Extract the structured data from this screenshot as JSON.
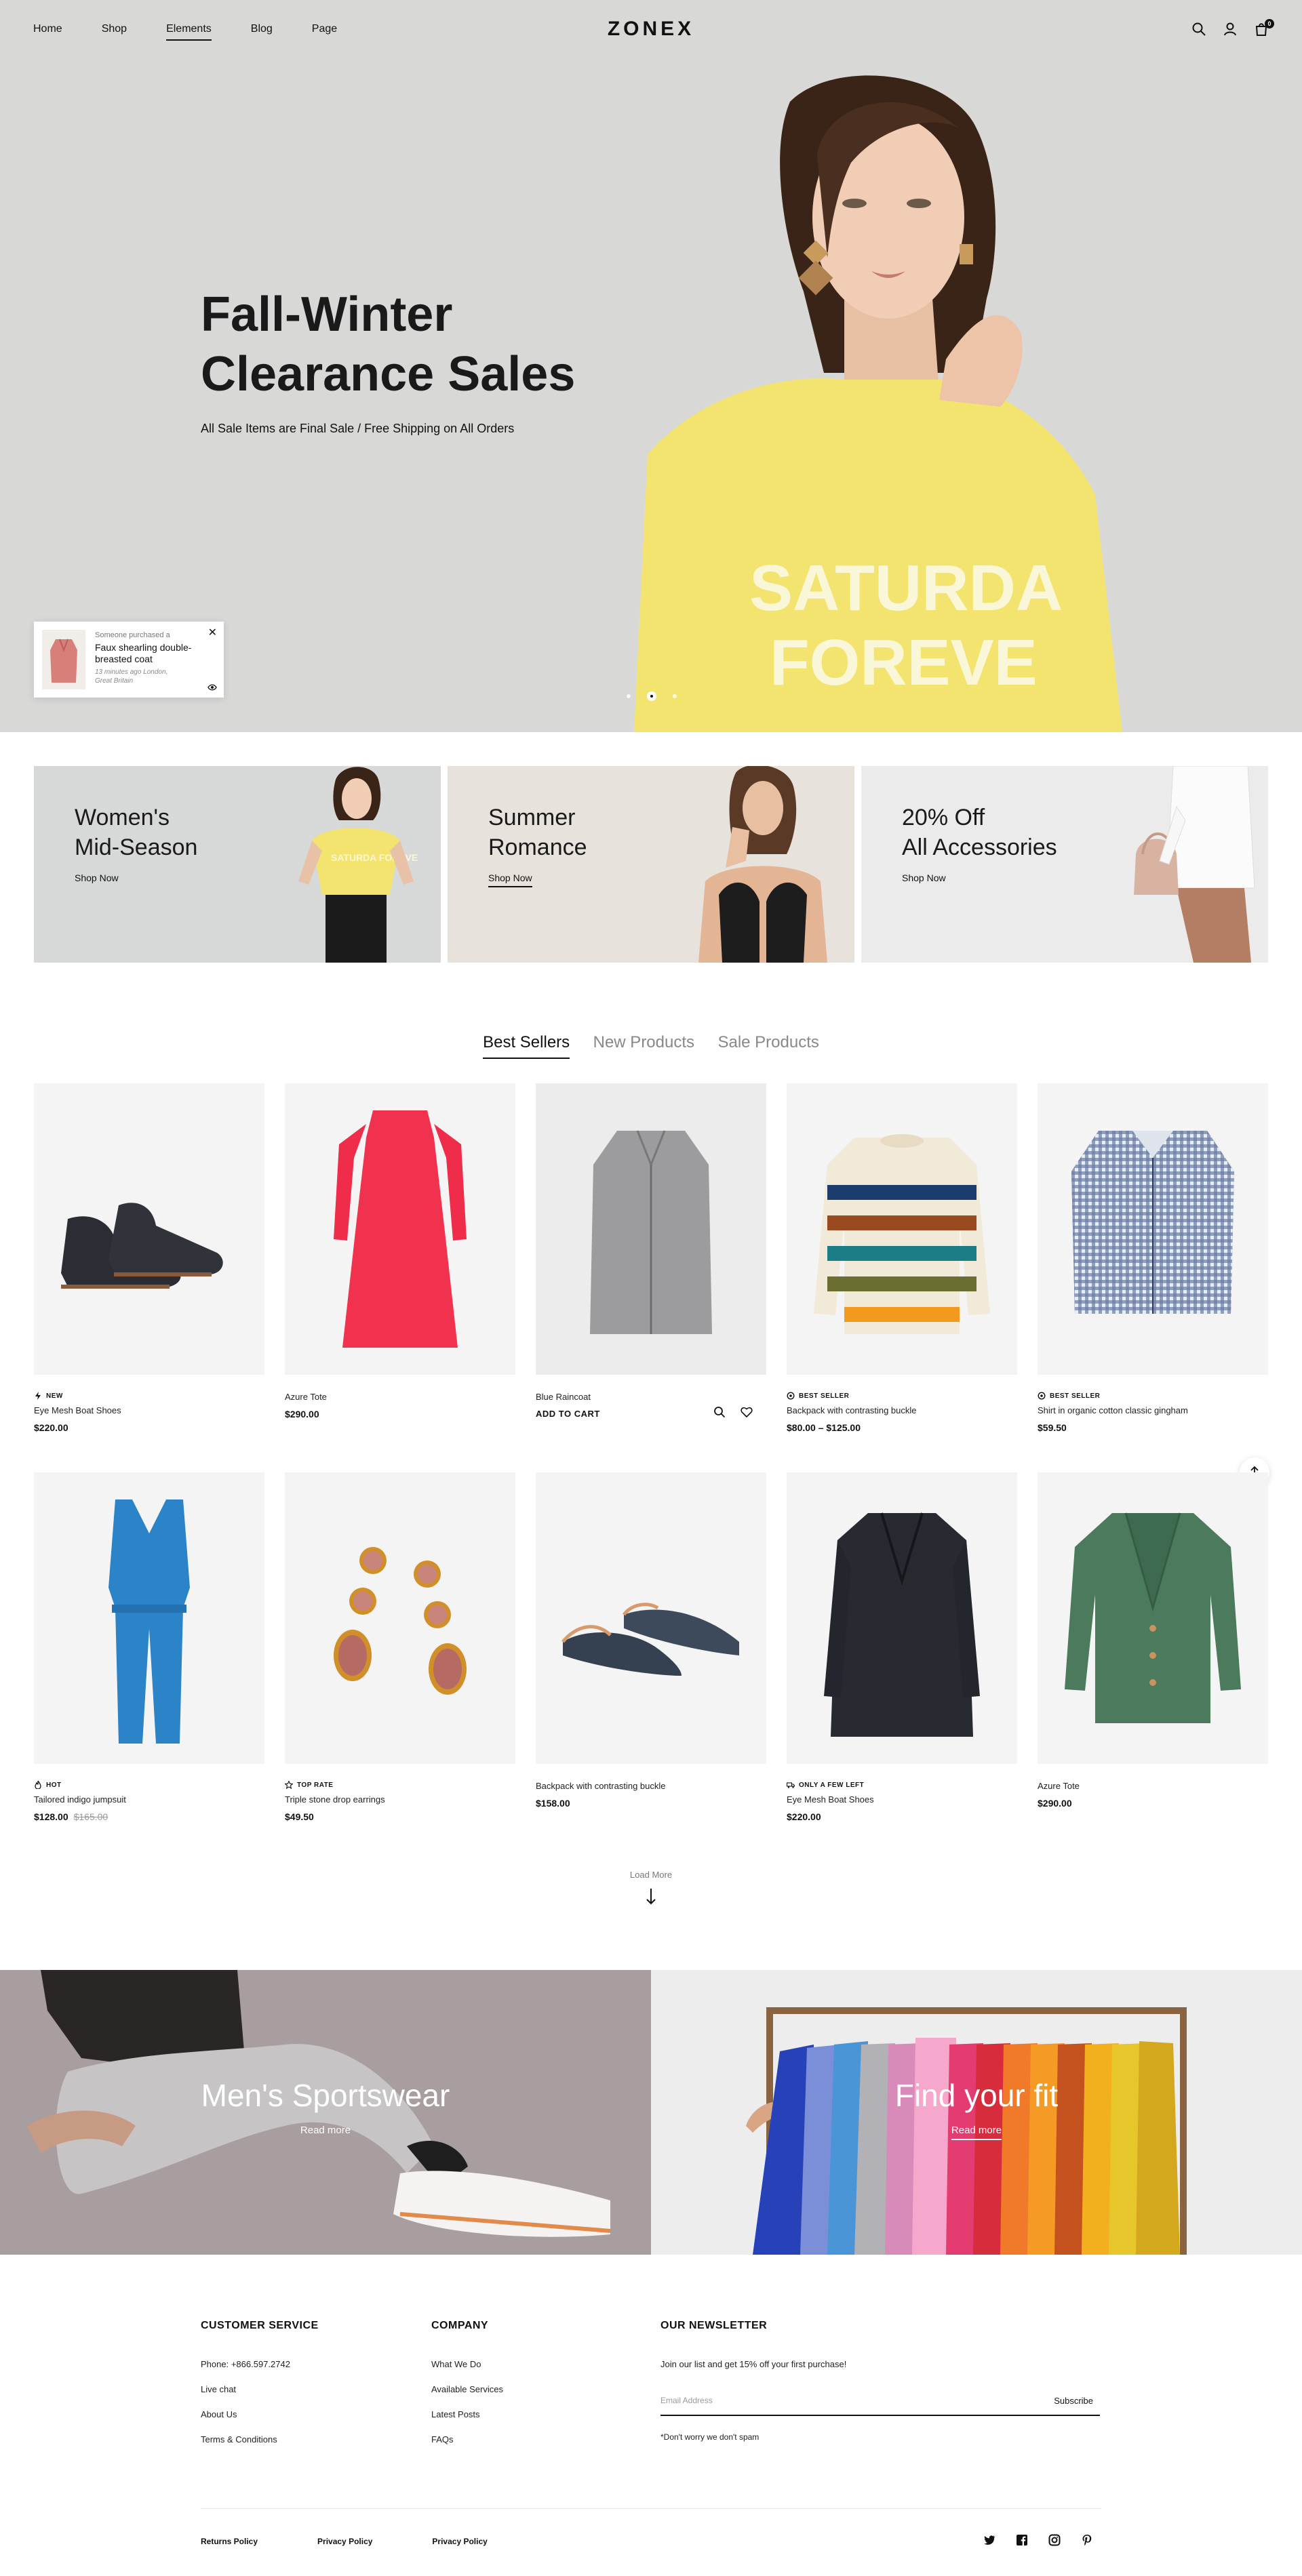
{
  "header": {
    "nav": [
      "Home",
      "Shop",
      "Elements",
      "Blog",
      "Page"
    ],
    "active_nav": "Elements",
    "logo": "ZONEX",
    "cart_count": "0",
    "icons": [
      "search-icon",
      "user-icon",
      "cart-icon"
    ]
  },
  "hero": {
    "title_line1": "Fall-Winter",
    "title_line2": "Clearance Sales",
    "subtitle": "All Sale Items are Final Sale / Free Shipping on All Orders",
    "tshirt_line1": "SATURDA",
    "tshirt_line2": "FOREVE",
    "slides": 3,
    "active_slide": 2
  },
  "popup": {
    "who": "Someone purchased a",
    "product": "Faux shearling double-breasted coat",
    "when": "13 minutes ago London, Great Britain"
  },
  "banners": [
    {
      "title_line1": "Women's",
      "title_line2": "Mid-Season",
      "link": "Shop Now",
      "shirt_text": "SATURDA FOREVE"
    },
    {
      "title_line1": "Summer",
      "title_line2": "Romance",
      "link": "Shop Now"
    },
    {
      "title_line1": "20% Off",
      "title_line2": "All Accessories",
      "link": "Shop Now"
    }
  ],
  "tabs": [
    "Best Sellers",
    "New Products",
    "Sale Products"
  ],
  "products": [
    {
      "badge": "NEW",
      "name": "Eye Mesh Boat Shoes",
      "price": "$220.00"
    },
    {
      "badge": "",
      "name": "Azure Tote",
      "price": "$290.00"
    },
    {
      "badge": "",
      "name": "Blue Raincoat",
      "price": "",
      "action": "ADD TO CART"
    },
    {
      "badge": "BEST SELLER",
      "name": "Backpack with contrasting buckle",
      "price": "$80.00 – $125.00"
    },
    {
      "badge": "BEST SELLER",
      "name": "Shirt in organic cotton classic gingham",
      "price": "$59.50"
    },
    {
      "badge": "HOT",
      "name": "Tailored indigo jumpsuit",
      "price": "$128.00",
      "old_price": "$165.00"
    },
    {
      "badge": "TOP RATE",
      "name": "Triple stone drop earrings",
      "price": "$49.50"
    },
    {
      "badge": "",
      "name": "Backpack with contrasting buckle",
      "price": "$158.00"
    },
    {
      "badge": "ONLY A FEW LEFT",
      "name": "Eye Mesh Boat Shoes",
      "price": "$220.00"
    },
    {
      "badge": "",
      "name": "Azure Tote",
      "price": "$290.00"
    }
  ],
  "load_more": "Load More",
  "promos": [
    {
      "title": "Men's Sportswear",
      "link": "Read more"
    },
    {
      "title": "Find your fit",
      "link": "Read more"
    }
  ],
  "footer": {
    "customer_service": {
      "heading": "CUSTOMER SERVICE",
      "links": [
        "Phone: +866.597.2742",
        "Live chat",
        "About Us",
        "Terms & Conditions"
      ]
    },
    "company": {
      "heading": "COMPANY",
      "links": [
        "What We Do",
        "Available Services",
        "Latest Posts",
        "FAQs"
      ]
    },
    "newsletter": {
      "heading": "OUR NEWSLETTER",
      "text": "Join our list and get 15% off your first purchase!",
      "placeholder": "Email Address",
      "button": "Subscribe",
      "note": "*Don't worry we don't spam"
    },
    "policies": [
      "Returns Policy",
      "Privacy Policy",
      "Privacy Policy"
    ],
    "social": [
      "twitter-icon",
      "facebook-icon",
      "instagram-icon",
      "pinterest-icon"
    ]
  }
}
